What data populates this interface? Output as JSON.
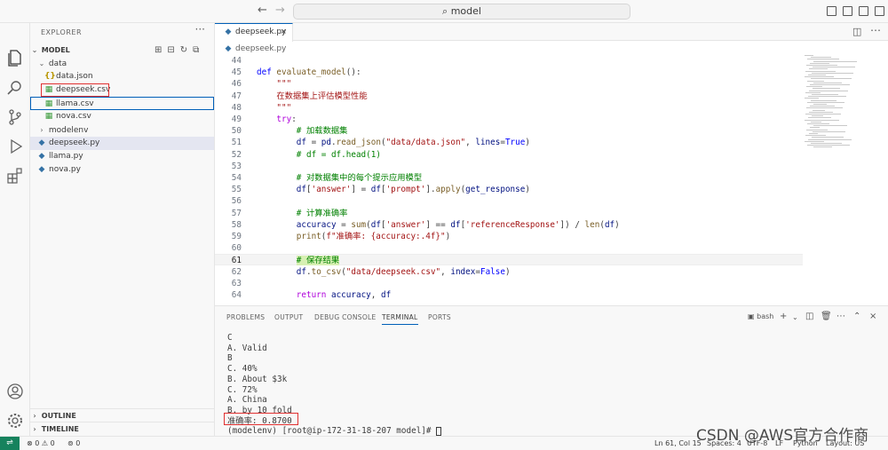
{
  "titlebar": {
    "search_text": "model",
    "search_icon": "search-icon",
    "back_icon": "arrow-left-icon",
    "forward_icon": "arrow-right-icon"
  },
  "activity": [
    "files-icon",
    "search-icon",
    "source-control-icon",
    "run-debug-icon",
    "extensions-icon",
    "account-icon",
    "gear-icon"
  ],
  "explorer": {
    "title": "EXPLORER",
    "more": "···",
    "folder": "MODEL",
    "tree": [
      {
        "label": "data",
        "kind": "folder",
        "expanded": true
      },
      {
        "label": "data.json",
        "kind": "json"
      },
      {
        "label": "deepseek.csv",
        "kind": "csv"
      },
      {
        "label": "llama.csv",
        "kind": "csv"
      },
      {
        "label": "nova.csv",
        "kind": "csv"
      },
      {
        "label": "modelenv",
        "kind": "folder",
        "expanded": false
      },
      {
        "label": "deepseek.py",
        "kind": "py"
      },
      {
        "label": "llama.py",
        "kind": "py"
      },
      {
        "label": "nova.py",
        "kind": "py"
      }
    ],
    "outline": "OUTLINE",
    "timeline": "TIMELINE"
  },
  "editor": {
    "tab": "deepseek.py",
    "breadcrumb": "deepseek.py",
    "current_line": 61,
    "lines": [
      {
        "n": "44",
        "t": ""
      },
      {
        "n": "45",
        "t": "def evaluate_model():"
      },
      {
        "n": "46",
        "t": "    \"\"\""
      },
      {
        "n": "47",
        "t": "    在数据集上评估模型性能"
      },
      {
        "n": "48",
        "t": "    \"\"\""
      },
      {
        "n": "49",
        "t": "    try:"
      },
      {
        "n": "50",
        "t": "        # 加载数据集"
      },
      {
        "n": "51",
        "t": "        df = pd.read_json(\"data/data.json\", lines=True)"
      },
      {
        "n": "52",
        "t": "        # df = df.head(1)"
      },
      {
        "n": "53",
        "t": ""
      },
      {
        "n": "54",
        "t": "        # 对数据集中的每个提示应用模型"
      },
      {
        "n": "55",
        "t": "        df['answer'] = df['prompt'].apply(get_response)"
      },
      {
        "n": "56",
        "t": ""
      },
      {
        "n": "57",
        "t": "        # 计算准确率"
      },
      {
        "n": "58",
        "t": "        accuracy = sum(df['answer'] == df['referenceResponse']) / len(df)"
      },
      {
        "n": "59",
        "t": "        print(f\"准确率: {accuracy:.4f}\")"
      },
      {
        "n": "60",
        "t": ""
      },
      {
        "n": "61",
        "t": "        # 保存结果"
      },
      {
        "n": "62",
        "t": "        df.to_csv(\"data/deepseek.csv\", index=False)"
      },
      {
        "n": "63",
        "t": ""
      },
      {
        "n": "64",
        "t": "        return accuracy, df"
      }
    ]
  },
  "panel": {
    "tabs": [
      "PROBLEMS",
      "OUTPUT",
      "DEBUG CONSOLE",
      "TERMINAL",
      "PORTS"
    ],
    "active_tab": "TERMINAL",
    "shell": "bash",
    "terminal": [
      "C",
      "A. Valid",
      "B",
      "C. 40%",
      "B. About $3k",
      "C. 72%",
      "A. China",
      "B. by 10 fold",
      "准确率: 0.8700",
      "(modelenv) [root@ip-172-31-18-207 model]# "
    ]
  },
  "status": {
    "errors": "0",
    "warnings": "0",
    "ports": "0",
    "position": "Ln 61, Col 15",
    "spaces": "Spaces: 4",
    "encoding": "UTF-8",
    "eol": "LF",
    "language": "Python",
    "layout": "Layout: US"
  },
  "watermark": "CSDN @AWS官方合作商",
  "colors": {
    "accent": "#005fb8",
    "highlight_box": "#e03030",
    "remote": "#16825d"
  }
}
